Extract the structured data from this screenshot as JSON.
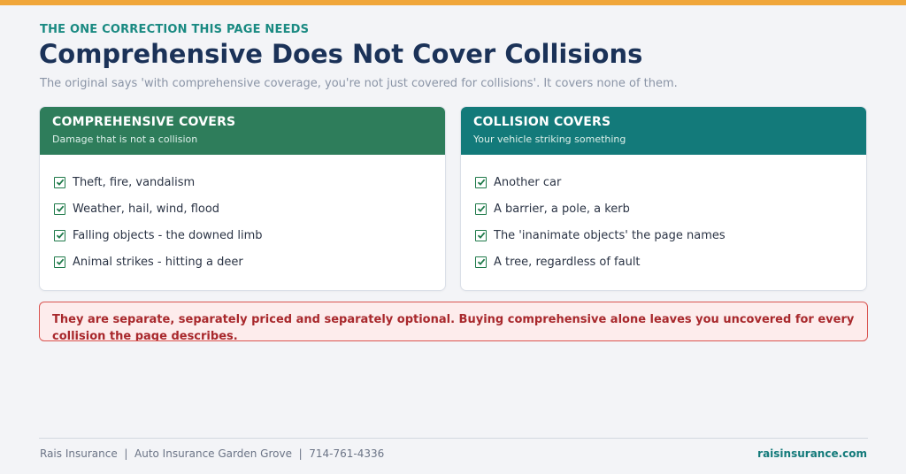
{
  "header": {
    "eyebrow": "THE ONE CORRECTION THIS PAGE NEEDS",
    "title": "Comprehensive Does Not Cover Collisions",
    "subtitle": "The original says 'with comprehensive coverage, you're not just covered for collisions'. It covers none of them."
  },
  "cards": [
    {
      "title": "COMPREHENSIVE COVERS",
      "subtitle": "Damage that is not a collision",
      "items": [
        "Theft, fire, vandalism",
        "Weather, hail, wind, flood",
        "Falling objects - the downed limb",
        "Animal strikes - hitting a deer"
      ]
    },
    {
      "title": "COLLISION COVERS",
      "subtitle": "Your vehicle striking something",
      "items": [
        "Another car",
        "A barrier, a pole, a kerb",
        "The 'inanimate objects' the page names",
        "A tree, regardless of fault"
      ]
    }
  ],
  "warning": "They are separate, separately priced and separately optional. Buying comprehensive alone leaves you uncovered for every collision the page describes.",
  "footer": {
    "left": "Rais Insurance  |  Auto Insurance Garden Grove  |  714-761-4336",
    "right": "raisinsurance.com"
  },
  "colors": {
    "accent_bar": "#f0a63a",
    "comprehensive_header": "#2e7d5b",
    "collision_header": "#137a7a",
    "warning_text": "#a8282c"
  },
  "icons": {
    "item_marker": "checkbox-checked-icon"
  }
}
